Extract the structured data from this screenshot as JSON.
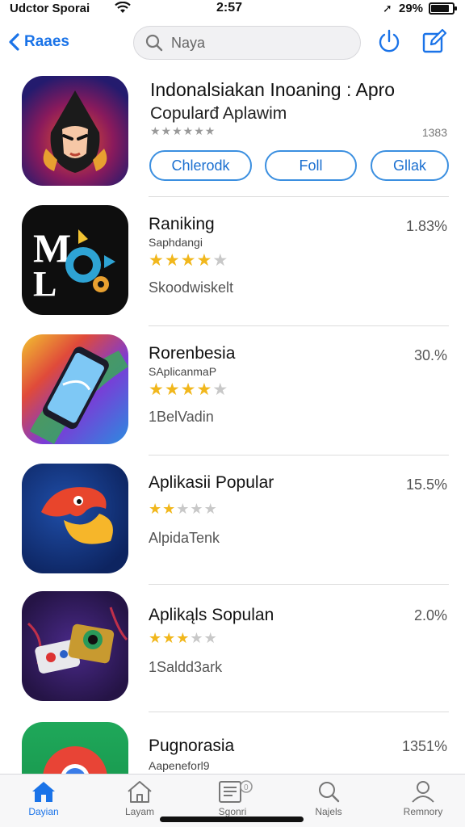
{
  "status_bar": {
    "carrier": "Udctor Sporai",
    "time": "2:57",
    "battery_percent": "29%",
    "battery_level": 0.85
  },
  "nav": {
    "back_label": "Raaes",
    "search_value": "Naya",
    "accent_color": "#1a73e8"
  },
  "featured": {
    "title": "Indonalsiakan Inoaning : Apro",
    "subtitle": "Copularđ Aplawim",
    "rating_stars": "★★★★★★",
    "count": "1383",
    "buttons": [
      "Chlerodk",
      "Foll",
      "Gllak"
    ]
  },
  "apps": [
    {
      "name": "Raniking",
      "developer": "Saphdangi",
      "stars": 4,
      "meta": "Skoodwiskelt",
      "percent": "1.83%",
      "icon": "mlo-icon"
    },
    {
      "name": "Rorenbesia",
      "developer": "SAplicanmaP",
      "stars": 4,
      "meta": "1BelVadin",
      "percent": "30.%",
      "icon": "phone-icon"
    },
    {
      "name": "Aplikasii Popular",
      "developer": "",
      "stars": 2,
      "meta": "AlpidaTenk",
      "percent": "15.5%",
      "icon": "bird-icon"
    },
    {
      "name": "Aplikąls Sopulan",
      "developer": "",
      "stars": 3,
      "meta": "1Saldd3ark",
      "percent": "2.0%",
      "icon": "game-icon"
    },
    {
      "name": "Pugnorasia",
      "developer": "Aapeneforl9",
      "stars": 0,
      "meta": "",
      "percent": "1351%",
      "icon": "chrome-icon"
    }
  ],
  "tabs": [
    {
      "label": "Dayian",
      "icon": "home-icon"
    },
    {
      "label": "Layam",
      "icon": "house-outline-icon"
    },
    {
      "label": "Sgonri",
      "icon": "book-icon"
    },
    {
      "label": "Najels",
      "icon": "search-icon"
    },
    {
      "label": "Remnory",
      "icon": "person-icon"
    }
  ],
  "active_tab": 0
}
